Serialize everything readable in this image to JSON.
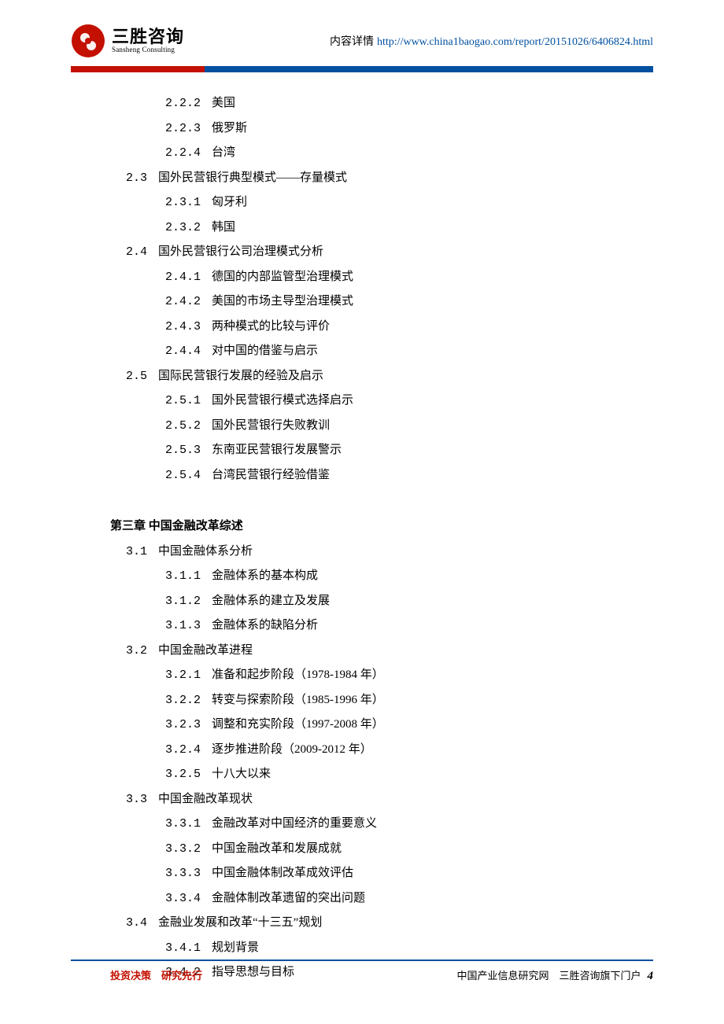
{
  "header": {
    "logo_cn": "三胜咨询",
    "logo_en": "Sansheng Consulting",
    "label": "内容详情",
    "url": "http://www.china1baogao.com/report/20151026/6406824.html"
  },
  "toc": [
    {
      "lvl": 3,
      "num": "2.2.2",
      "title": "美国"
    },
    {
      "lvl": 3,
      "num": "2.2.3",
      "title": "俄罗斯"
    },
    {
      "lvl": 3,
      "num": "2.2.4",
      "title": "台湾"
    },
    {
      "lvl": 2,
      "num": "2.3",
      "title": "国外民营银行典型模式——存量模式"
    },
    {
      "lvl": 3,
      "num": "2.3.1",
      "title": "匈牙利"
    },
    {
      "lvl": 3,
      "num": "2.3.2",
      "title": "韩国"
    },
    {
      "lvl": 2,
      "num": "2.4",
      "title": "国外民营银行公司治理模式分析"
    },
    {
      "lvl": 3,
      "num": "2.4.1",
      "title": "德国的内部监管型治理模式"
    },
    {
      "lvl": 3,
      "num": "2.4.2",
      "title": "美国的市场主导型治理模式"
    },
    {
      "lvl": 3,
      "num": "2.4.3",
      "title": "两种模式的比较与评价"
    },
    {
      "lvl": 3,
      "num": "2.4.4",
      "title": "对中国的借鉴与启示"
    },
    {
      "lvl": 2,
      "num": "2.5",
      "title": "国际民营银行发展的经验及启示"
    },
    {
      "lvl": 3,
      "num": "2.5.1",
      "title": "国外民营银行模式选择启示"
    },
    {
      "lvl": 3,
      "num": "2.5.2",
      "title": "国外民营银行失败教训"
    },
    {
      "lvl": 3,
      "num": "2.5.3",
      "title": "东南亚民营银行发展警示"
    },
    {
      "lvl": 3,
      "num": "2.5.4",
      "title": "台湾民营银行经验借鉴"
    },
    {
      "lvl": 1,
      "num": "第三章",
      "title": "中国金融改革综述"
    },
    {
      "lvl": 2,
      "num": "3.1",
      "title": "中国金融体系分析"
    },
    {
      "lvl": 3,
      "num": "3.1.1",
      "title": "金融体系的基本构成"
    },
    {
      "lvl": 3,
      "num": "3.1.2",
      "title": "金融体系的建立及发展"
    },
    {
      "lvl": 3,
      "num": "3.1.3",
      "title": "金融体系的缺陷分析"
    },
    {
      "lvl": 2,
      "num": "3.2",
      "title": "中国金融改革进程"
    },
    {
      "lvl": 3,
      "num": "3.2.1",
      "title": "准备和起步阶段（1978-1984 年）"
    },
    {
      "lvl": 3,
      "num": "3.2.2",
      "title": "转变与探索阶段（1985-1996 年）"
    },
    {
      "lvl": 3,
      "num": "3.2.3",
      "title": "调整和充实阶段（1997-2008 年）"
    },
    {
      "lvl": 3,
      "num": "3.2.4",
      "title": "逐步推进阶段（2009-2012 年）"
    },
    {
      "lvl": 3,
      "num": "3.2.5",
      "title": "十八大以来"
    },
    {
      "lvl": 2,
      "num": "3.3",
      "title": "中国金融改革现状"
    },
    {
      "lvl": 3,
      "num": "3.3.1",
      "title": "金融改革对中国经济的重要意义"
    },
    {
      "lvl": 3,
      "num": "3.3.2",
      "title": "中国金融改革和发展成就"
    },
    {
      "lvl": 3,
      "num": "3.3.3",
      "title": "中国金融体制改革成效评估"
    },
    {
      "lvl": 3,
      "num": "3.3.4",
      "title": "金融体制改革遗留的突出问题"
    },
    {
      "lvl": 2,
      "num": "3.4",
      "title": "金融业发展和改革“十三五”规划"
    },
    {
      "lvl": 3,
      "num": "3.4.1",
      "title": "规划背景"
    },
    {
      "lvl": 3,
      "num": "3.4.2",
      "title": "指导思想与目标"
    }
  ],
  "footer": {
    "left": "投资决策　研究先行",
    "right": "中国产业信息研究网　三胜咨询旗下门户",
    "page": "4"
  }
}
